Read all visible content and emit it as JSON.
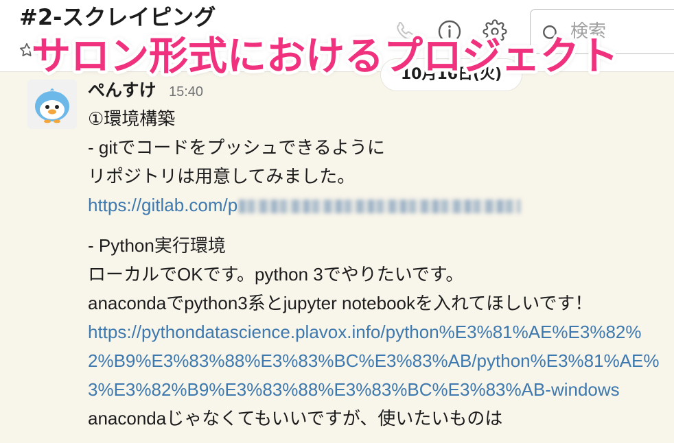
{
  "header": {
    "channel_name": "#2-スクレイピング",
    "icons": {
      "star": "star-icon",
      "call": "phone-icon",
      "details": "info-icon",
      "settings": "gear-icon",
      "search": "search-icon"
    },
    "search": {
      "placeholder": "検索"
    }
  },
  "overlay": {
    "title": "サロン形式におけるプロジェクト"
  },
  "date_divider": {
    "label": "10月16日(火)"
  },
  "message": {
    "avatar": "penguin-avatar",
    "author": "ぺんすけ",
    "time": "15:40",
    "section1": {
      "lines": [
        "①環境構築",
        "- gitでコードをプッシュできるように",
        "リポジトリは用意してみました。"
      ],
      "link": "https://gitlab.com/p"
    },
    "section2": {
      "lines": [
        "- Python実行環境",
        "ローカルでOKです。python 3でやりたいです。",
        "anacondaでpython3系とjupyter notebookを入れてほしいです！"
      ],
      "link_lines": [
        "https://pythondatascience.plavox.info/python%E3%81%AE%E3%82%",
        "2%B9%E3%83%88%E3%83%BC%E3%83%AB/python%E3%81%AE%",
        "3%E3%82%B9%E3%83%88%E3%83%BC%E3%83%AB-windows"
      ],
      "trailing_line": "anacondaじゃなくてもいいですが、使いたいものは"
    }
  },
  "colors": {
    "background": "#f8f5ea",
    "text": "#1d1c1d",
    "muted": "#717274",
    "link": "#3d78ae",
    "pink": "#f0317d"
  }
}
